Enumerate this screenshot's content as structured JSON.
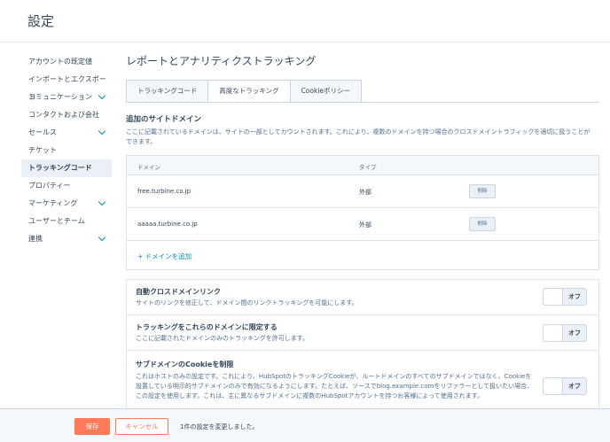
{
  "header": {
    "title": "設定"
  },
  "sidebar": {
    "items": [
      {
        "label": "アカウントの既定値",
        "chevron": false,
        "active": false
      },
      {
        "label": "インポートとエクスポート",
        "chevron": false,
        "active": false
      },
      {
        "label": "コミュニケーション",
        "chevron": true,
        "active": false
      },
      {
        "label": "コンタクトおよび会社",
        "chevron": false,
        "active": false
      },
      {
        "label": "セールス",
        "chevron": true,
        "active": false
      },
      {
        "label": "チケット",
        "chevron": false,
        "active": false
      },
      {
        "label": "トラッキングコード",
        "chevron": false,
        "active": true
      },
      {
        "label": "プロパティー",
        "chevron": false,
        "active": false
      },
      {
        "label": "マーケティング",
        "chevron": true,
        "active": false
      },
      {
        "label": "ユーザーとチーム",
        "chevron": false,
        "active": false
      },
      {
        "label": "連携",
        "chevron": true,
        "active": false
      }
    ]
  },
  "main": {
    "title": "レポートとアナリティクストラッキング",
    "tabs": [
      {
        "label": "トラッキングコード",
        "active": false
      },
      {
        "label": "高度なトラッキング",
        "active": true
      },
      {
        "label": "Cookieポリシー",
        "active": false
      }
    ],
    "domains_section": {
      "title": "追加のサイトドメイン",
      "description": "ここに記載されているドメインは、サイトの一部としてカウントされます。これにより、複数のドメインを持つ場合のクロスドメイントラフィックを適切に扱うことができます。",
      "col_domain": "ドメイン",
      "col_type": "タイプ",
      "rows": [
        {
          "domain": "free.turbine.co.jp",
          "type": "外部",
          "delete_label": "削除"
        },
        {
          "domain": "aaaaa.turbine.co.jp",
          "type": "外部",
          "delete_label": "削除"
        }
      ],
      "add_label": "+ ドメインを追加"
    },
    "toggles": [
      {
        "title": "自動クロスドメインリンク",
        "description": "サイトのリンクを修正して、ドメイン間のリンクトラッキングを可能にします。",
        "state": "オフ"
      },
      {
        "title": "トラッキングをこれらのドメインに限定する",
        "description": "ここに記載されたドメインのみのトラッキングを許可します。",
        "state": "オフ"
      },
      {
        "title": "サブドメインのCookieを制限",
        "description": "これはホストのみの設定です。これにより、HubSpotのトラッキングCookieが、ルートドメインのすべてのサブドメインではなく、Cookieを設置している明示的サブドメインのみで有効になるようにします。たとえば、ソースでblog.example.comをリファラーとして扱いたい場合、この設定を使用します。これは、主に異なるサブドメインに複数のHubSpotアカウントを持つお客様によって使用されます。",
        "state": "オフ"
      }
    ]
  },
  "footer": {
    "save_label": "保存",
    "cancel_label": "キャンセル",
    "status": "1件の設定を変更しました。"
  },
  "colors": {
    "accent": "#ff7a59",
    "link": "#0091ae",
    "text": "#33475b"
  }
}
